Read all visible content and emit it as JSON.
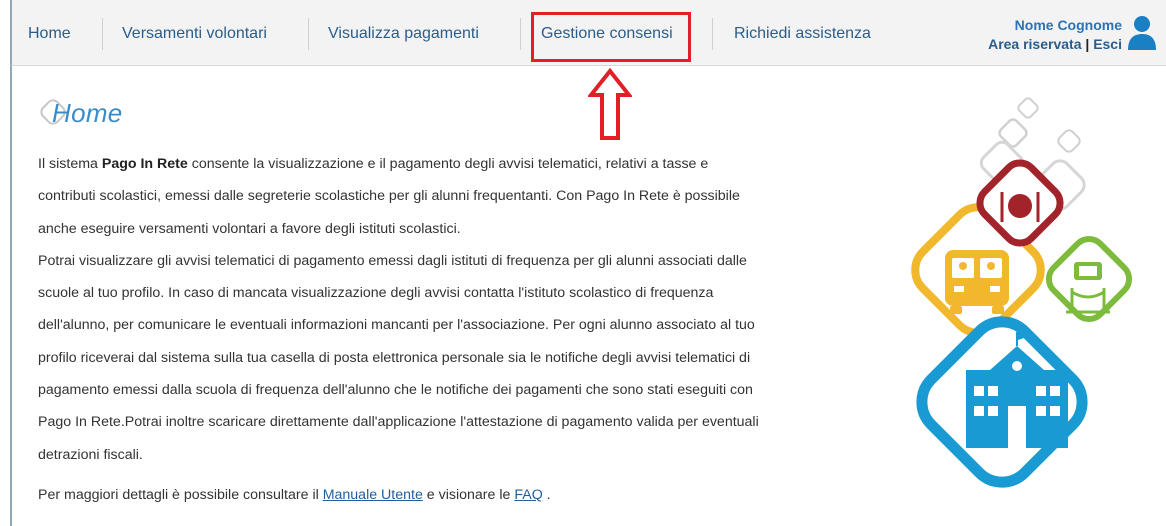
{
  "nav": {
    "items": [
      {
        "label": "Home"
      },
      {
        "label": "Versamenti volontari"
      },
      {
        "label": "Visualizza pagamenti"
      },
      {
        "label": "Gestione consensi"
      },
      {
        "label": "Richiedi assistenza"
      }
    ]
  },
  "user": {
    "name": "Nome Cognome",
    "area_label": "Area riservata",
    "separator": " | ",
    "logout_label": "Esci"
  },
  "page": {
    "title": "Home",
    "p1_prefix": "Il sistema ",
    "p1_bold": "Pago In Rete",
    "p1_rest": " consente la visualizzazione e il pagamento degli avvisi telematici, relativi a tasse e",
    "p2": "contributi scolastici, emessi dalle segreterie scolastiche per gli alunni frequentanti. Con Pago In Rete è possibile",
    "p3": "anche eseguire versamenti volontari a favore degli istituti scolastici.",
    "p4": "Potrai visualizzare gli avvisi telematici di pagamento emessi dagli istituti di frequenza per gli alunni associati dalle",
    "p5": "scuole al tuo profilo. In caso di mancata visualizzazione degli avvisi contatta l'istituto scolastico di frequenza",
    "p6": "dell'alunno, per comunicare le eventuali informazioni mancanti per l'associazione. Per ogni alunno associato al tuo",
    "p7": "profilo riceverai dal sistema sulla tua casella di posta elettronica personale sia le notifiche degli avvisi telematici di",
    "p8": "pagamento emessi dalla scuola di frequenza dell'alunno che le notifiche dei pagamenti che sono stati eseguiti con",
    "p9": "Pago In Rete.Potrai inoltre scaricare direttamente dall'applicazione l'attestazione di pagamento valida per eventuali",
    "p10": "detrazioni fiscali.",
    "footer_prefix": "Per maggiori dettagli è possibile consultare il ",
    "manual_link": "Manuale Utente",
    "footer_mid": " e visionare le ",
    "faq_link": "FAQ",
    "footer_suffix": " ."
  },
  "colors": {
    "accent": "#3a8cc8",
    "highlight": "#e01f26",
    "red_tile": "#a3232a",
    "yellow_tile": "#f1b82d",
    "green_tile": "#7dbb3c",
    "blue_tile": "#1a9ad3"
  }
}
